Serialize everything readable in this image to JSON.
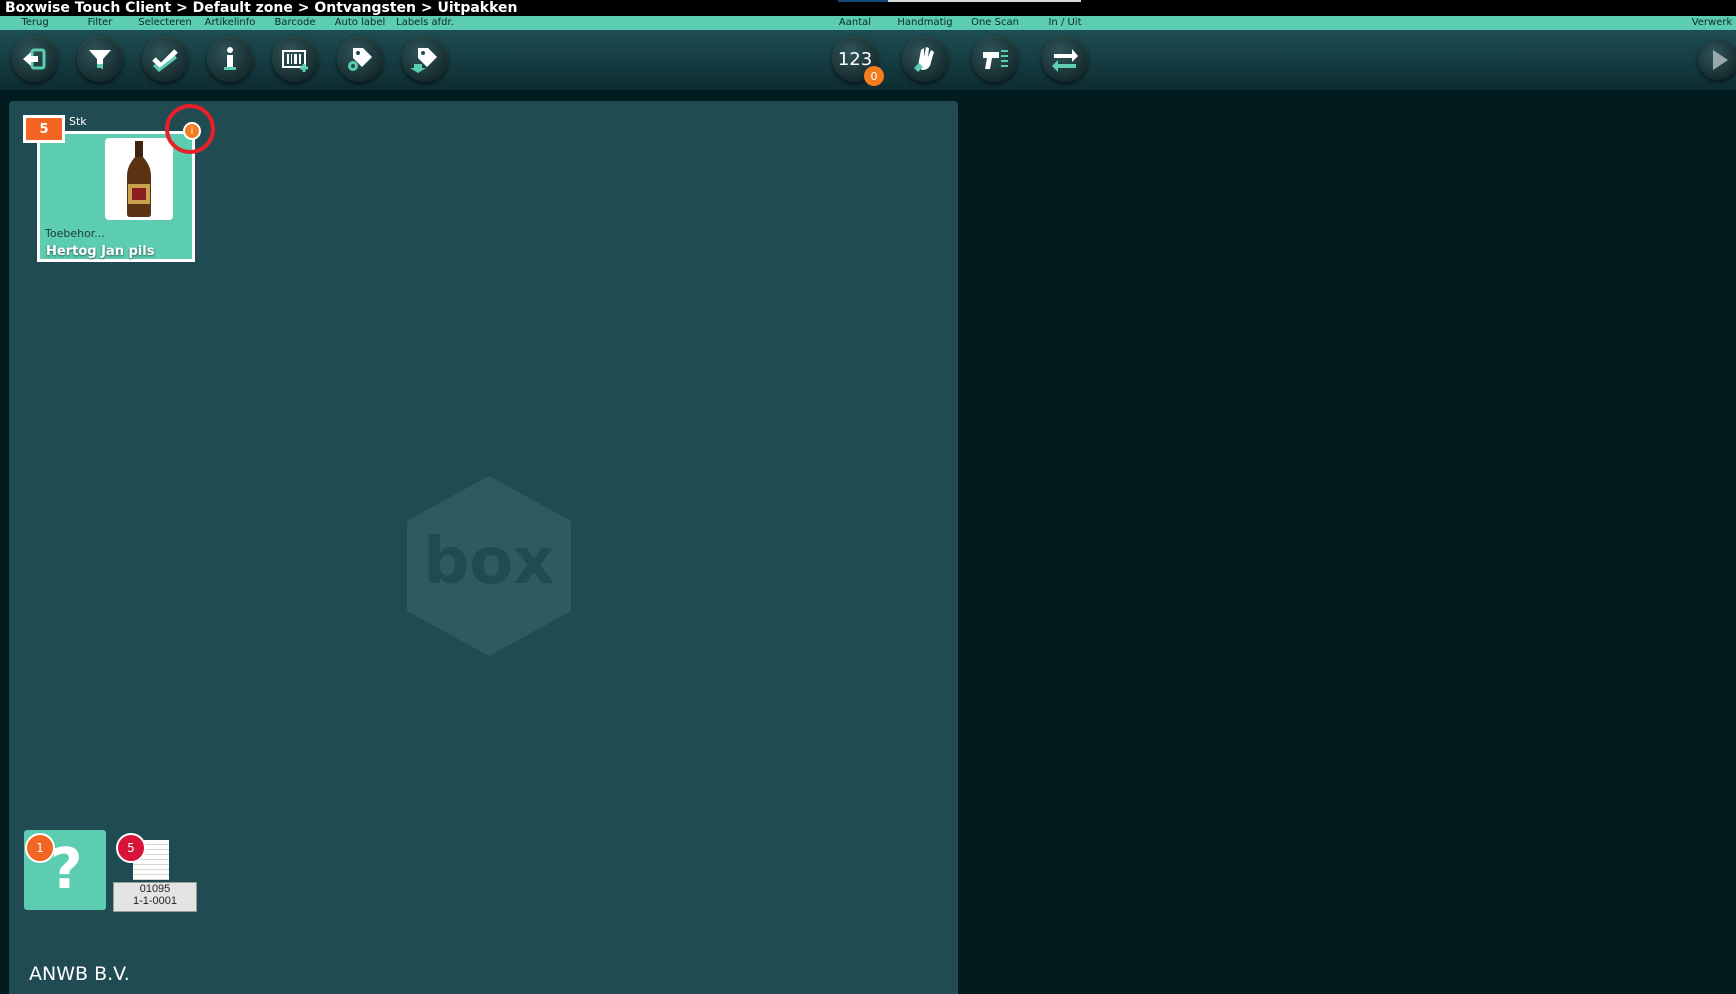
{
  "window": {
    "title": "Boxwise Touch Client > Default zone > Ontvangsten > Uitpakken"
  },
  "toolbar": {
    "labels": {
      "back": "Terug",
      "filter": "Filter",
      "select": "Selecteren",
      "article_info": "Artikelinfo",
      "barcode": "Barcode",
      "auto_label": "Auto label",
      "labels_print": "Labels afdr.",
      "quantity": "Aantal",
      "manual": "Handmatig",
      "one_scan": "One Scan",
      "in_out": "In / Uit",
      "process": "Verwerk"
    },
    "quantity_value": "123",
    "quantity_badge": "0",
    "icons": [
      "exit-icon",
      "filter-icon",
      "check-icon",
      "info-icon",
      "barcode-icon",
      "tag-gear-icon",
      "tag-print-icon",
      "hand-icon",
      "scanner-icon",
      "swap-arrows-icon",
      "play-icon"
    ]
  },
  "product_card": {
    "quantity": "5",
    "unit": "Stk",
    "info_marker": "i",
    "category": "Toebehor...",
    "name": "Hertog Jan pils",
    "image_icon": "beer-bottle-icon"
  },
  "watermark": {
    "text": "box"
  },
  "bottom_tiles": {
    "unknown": {
      "badge": "1",
      "symbol": "?"
    },
    "document": {
      "badge": "5",
      "code": "01095",
      "location": "1-1-0001"
    }
  },
  "footer": {
    "company": "ANWB B.V."
  },
  "colors": {
    "accent": "#5ccdb0",
    "badge_orange": "#f26522",
    "badge_red": "#d8143a",
    "highlight_red": "#e8202a",
    "panel": "#214b53",
    "background": "#021b1f"
  }
}
